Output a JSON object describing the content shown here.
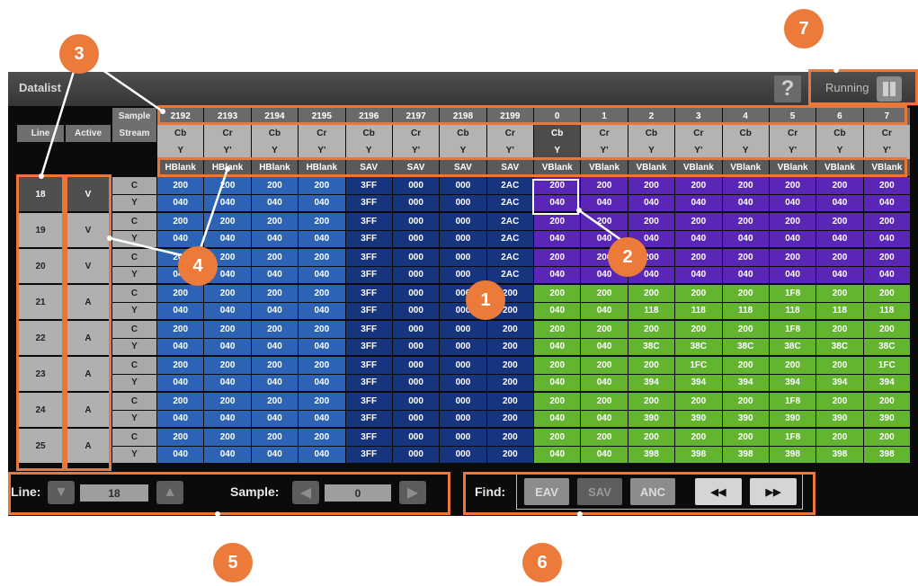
{
  "window": {
    "title": "Datalist"
  },
  "status": {
    "state": "Running",
    "help_label": "?"
  },
  "colors": {
    "hblank": "#2c63b4",
    "sav": "#17357f",
    "vblank": "#5a26b5",
    "active_video": "#63b42e",
    "accent": "#ec7b3b"
  },
  "header": {
    "sample_label": "Sample",
    "line_label": "Line",
    "active_label": "Active",
    "stream_label": "Stream"
  },
  "columns": [
    {
      "sample": "2192",
      "cb": "Cb",
      "y": "Y",
      "type": "HBlank"
    },
    {
      "sample": "2193",
      "cb": "Cr",
      "y": "Y'",
      "type": "HBlank"
    },
    {
      "sample": "2194",
      "cb": "Cb",
      "y": "Y",
      "type": "HBlank"
    },
    {
      "sample": "2195",
      "cb": "Cr",
      "y": "Y'",
      "type": "HBlank"
    },
    {
      "sample": "2196",
      "cb": "Cb",
      "y": "Y",
      "type": "SAV"
    },
    {
      "sample": "2197",
      "cb": "Cr",
      "y": "Y'",
      "type": "SAV"
    },
    {
      "sample": "2198",
      "cb": "Cb",
      "y": "Y",
      "type": "SAV"
    },
    {
      "sample": "2199",
      "cb": "Cr",
      "y": "Y'",
      "type": "SAV"
    },
    {
      "sample": "0",
      "cb": "Cb",
      "y": "Y",
      "type": "VBlank"
    },
    {
      "sample": "1",
      "cb": "Cr",
      "y": "Y'",
      "type": "VBlank"
    },
    {
      "sample": "2",
      "cb": "Cb",
      "y": "Y",
      "type": "VBlank"
    },
    {
      "sample": "3",
      "cb": "Cr",
      "y": "Y'",
      "type": "VBlank"
    },
    {
      "sample": "4",
      "cb": "Cb",
      "y": "Y",
      "type": "VBlank"
    },
    {
      "sample": "5",
      "cb": "Cr",
      "y": "Y'",
      "type": "VBlank"
    },
    {
      "sample": "6",
      "cb": "Cb",
      "y": "Y",
      "type": "VBlank"
    },
    {
      "sample": "7",
      "cb": "Cr",
      "y": "Y'",
      "type": "VBlank"
    }
  ],
  "rows": [
    {
      "line": "18",
      "active": "V",
      "c": [
        "200",
        "200",
        "200",
        "200",
        "3FF",
        "000",
        "000",
        "2AC",
        "200",
        "200",
        "200",
        "200",
        "200",
        "200",
        "200",
        "200"
      ],
      "y": [
        "040",
        "040",
        "040",
        "040",
        "3FF",
        "000",
        "000",
        "2AC",
        "040",
        "040",
        "040",
        "040",
        "040",
        "040",
        "040",
        "040"
      ]
    },
    {
      "line": "19",
      "active": "V",
      "c": [
        "200",
        "200",
        "200",
        "200",
        "3FF",
        "000",
        "000",
        "2AC",
        "200",
        "200",
        "200",
        "200",
        "200",
        "200",
        "200",
        "200"
      ],
      "y": [
        "040",
        "040",
        "040",
        "040",
        "3FF",
        "000",
        "000",
        "2AC",
        "040",
        "040",
        "040",
        "040",
        "040",
        "040",
        "040",
        "040"
      ]
    },
    {
      "line": "20",
      "active": "V",
      "c": [
        "200",
        "200",
        "200",
        "200",
        "3FF",
        "000",
        "000",
        "2AC",
        "200",
        "200",
        "200",
        "200",
        "200",
        "200",
        "200",
        "200"
      ],
      "y": [
        "040",
        "040",
        "040",
        "040",
        "3FF",
        "000",
        "000",
        "2AC",
        "040",
        "040",
        "040",
        "040",
        "040",
        "040",
        "040",
        "040"
      ]
    },
    {
      "line": "21",
      "active": "A",
      "c": [
        "200",
        "200",
        "200",
        "200",
        "3FF",
        "000",
        "000",
        "200",
        "200",
        "200",
        "200",
        "200",
        "200",
        "1F8",
        "200",
        "200"
      ],
      "y": [
        "040",
        "040",
        "040",
        "040",
        "3FF",
        "000",
        "000",
        "200",
        "040",
        "040",
        "118",
        "118",
        "118",
        "118",
        "118",
        "118"
      ]
    },
    {
      "line": "22",
      "active": "A",
      "c": [
        "200",
        "200",
        "200",
        "200",
        "3FF",
        "000",
        "000",
        "200",
        "200",
        "200",
        "200",
        "200",
        "200",
        "1F8",
        "200",
        "200"
      ],
      "y": [
        "040",
        "040",
        "040",
        "040",
        "3FF",
        "000",
        "000",
        "200",
        "040",
        "040",
        "38C",
        "38C",
        "38C",
        "38C",
        "38C",
        "38C"
      ]
    },
    {
      "line": "23",
      "active": "A",
      "c": [
        "200",
        "200",
        "200",
        "200",
        "3FF",
        "000",
        "000",
        "200",
        "200",
        "200",
        "200",
        "1FC",
        "200",
        "200",
        "200",
        "1FC"
      ],
      "y": [
        "040",
        "040",
        "040",
        "040",
        "3FF",
        "000",
        "000",
        "200",
        "040",
        "040",
        "394",
        "394",
        "394",
        "394",
        "394",
        "394"
      ]
    },
    {
      "line": "24",
      "active": "A",
      "c": [
        "200",
        "200",
        "200",
        "200",
        "3FF",
        "000",
        "000",
        "200",
        "200",
        "200",
        "200",
        "200",
        "200",
        "1F8",
        "200",
        "200"
      ],
      "y": [
        "040",
        "040",
        "040",
        "040",
        "3FF",
        "000",
        "000",
        "200",
        "040",
        "040",
        "390",
        "390",
        "390",
        "390",
        "390",
        "390"
      ]
    },
    {
      "line": "25",
      "active": "A",
      "c": [
        "200",
        "200",
        "200",
        "200",
        "3FF",
        "000",
        "000",
        "200",
        "200",
        "200",
        "200",
        "200",
        "200",
        "1F8",
        "200",
        "200"
      ],
      "y": [
        "040",
        "040",
        "040",
        "040",
        "3FF",
        "000",
        "000",
        "200",
        "040",
        "040",
        "398",
        "398",
        "398",
        "398",
        "398",
        "398"
      ]
    }
  ],
  "stream_names": {
    "c": "C",
    "y": "Y"
  },
  "controls": {
    "line_label": "Line:",
    "line_value": "18",
    "sample_label": "Sample:",
    "sample_value": "0"
  },
  "find": {
    "label": "Find:",
    "eav": "EAV",
    "sav": "SAV",
    "anc": "ANC",
    "prev": "◀◀",
    "next": "▶▶"
  },
  "callouts": [
    "1",
    "2",
    "3",
    "4",
    "5",
    "6",
    "7"
  ]
}
